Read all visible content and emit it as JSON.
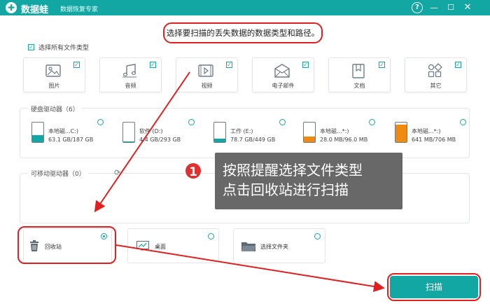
{
  "window": {
    "app_name": "数据蛙",
    "subtitle": "数据恢复专家",
    "help_label": "?",
    "minimize_label": "—",
    "maximize_label": "☐",
    "close_label": "✕"
  },
  "prompt": "选择要扫描的丢失数据的数据类型和路径。",
  "select_all": {
    "label": "选择所有文件类型",
    "checked": true
  },
  "file_types": [
    {
      "label": "图片",
      "icon": "image-icon",
      "checked": true
    },
    {
      "label": "音频",
      "icon": "music-icon",
      "checked": true
    },
    {
      "label": "视频",
      "icon": "video-icon",
      "checked": true
    },
    {
      "label": "电子邮件",
      "icon": "email-icon",
      "checked": true
    },
    {
      "label": "文档",
      "icon": "document-icon",
      "checked": true
    },
    {
      "label": "其它",
      "icon": "other-icon",
      "checked": true
    }
  ],
  "hard_drives": {
    "title": "硬盘驱动器（6）",
    "items": [
      {
        "name": "本地磁...C:)",
        "size": "63.1 GB/187 GB",
        "used_fraction": 0.34,
        "color": "#12a7a3"
      },
      {
        "name": "软件 (D:)",
        "size": "4.4 GB/293 GB",
        "used_fraction": 0.02,
        "color": "#12a7a3"
      },
      {
        "name": "工作 (E:)",
        "size": "78.7 GB/449 GB",
        "used_fraction": 0.18,
        "color": "#12a7a3"
      },
      {
        "name": "本地磁...*:)",
        "size": "28.0 MB/96.0 MB",
        "used_fraction": 0.29,
        "color": "#f08a10"
      },
      {
        "name": "本地磁...*:)",
        "size": "641 MB/706 MB",
        "used_fraction": 0.91,
        "color": "#f08a10"
      }
    ]
  },
  "removable": {
    "title": "可移动驱动器（0）"
  },
  "locations": [
    {
      "label": "回收站",
      "icon": "trash-icon",
      "selected": true
    },
    {
      "label": "桌面",
      "icon": "desktop-icon",
      "selected": false
    },
    {
      "label": "选择文件夹",
      "icon": "folder-icon",
      "selected": false
    }
  ],
  "tooltip": {
    "number": "1",
    "line1": "按照提醒选择文件类型",
    "line2": "点击回收站进行扫描"
  },
  "scan_button": "扫描",
  "colors": {
    "accent": "#12a7a3",
    "highlight": "#e02020",
    "warning": "#f08a10"
  }
}
